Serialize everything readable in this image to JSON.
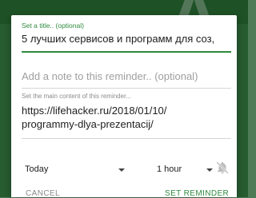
{
  "background": {
    "letter": "A"
  },
  "dialog": {
    "title_label": "Set a title.. (optional)",
    "title_value": "5 лучших сервисов и программ для соз,",
    "note_placeholder": "Add a note to this reminder.. (optional)",
    "content_label": "Set the main content of this reminder...",
    "content_value": "https://lifehacker.ru/2018/01/10/\nprogrammy-dlya-prezentacij/",
    "date_selected": "Today",
    "time_selected": "1 hour",
    "notification_icon": "bell-off-icon",
    "cancel_label": "CANCEL",
    "set_label": "SET REMINDER"
  },
  "colors": {
    "accent": "#2e8b3e",
    "background_green": "#3d8d4a"
  }
}
